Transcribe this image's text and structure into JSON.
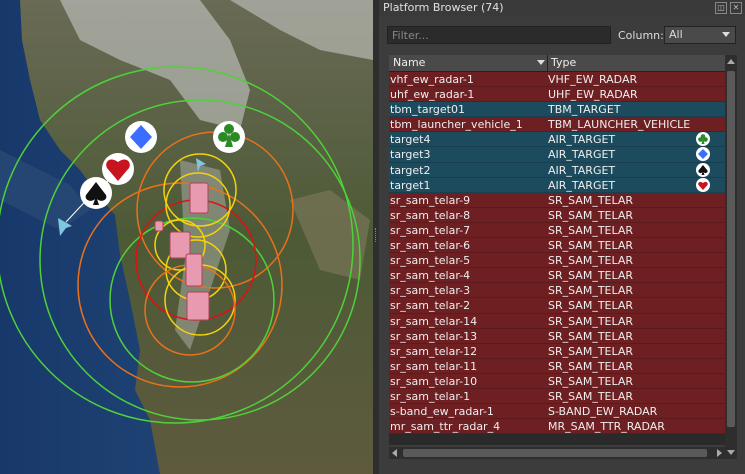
{
  "panel": {
    "title": "Platform Browser (74)",
    "filter_placeholder": "Filter...",
    "column_label": "Column:",
    "column_value": "All"
  },
  "table": {
    "headers": [
      "Name",
      "Type"
    ],
    "rows": [
      {
        "name": "vhf_ew_radar-1",
        "type": "VHF_EW_RADAR",
        "color": "red",
        "icon": ""
      },
      {
        "name": "uhf_ew_radar-1",
        "type": "UHF_EW_RADAR",
        "color": "red",
        "icon": ""
      },
      {
        "name": "tbm_target01",
        "type": "TBM_TARGET",
        "color": "teal",
        "icon": ""
      },
      {
        "name": "tbm_launcher_vehicle_1",
        "type": "TBM_LAUNCHER_VEHICLE",
        "color": "red",
        "icon": ""
      },
      {
        "name": "target4",
        "type": "AIR_TARGET",
        "color": "teal",
        "icon": "club-icon"
      },
      {
        "name": "target3",
        "type": "AIR_TARGET",
        "color": "teal",
        "icon": "diamond-icon"
      },
      {
        "name": "target2",
        "type": "AIR_TARGET",
        "color": "teal",
        "icon": "spade-icon"
      },
      {
        "name": "target1",
        "type": "AIR_TARGET",
        "color": "teal",
        "icon": "heart-icon"
      },
      {
        "name": "sr_sam_telar-9",
        "type": "SR_SAM_TELAR",
        "color": "red",
        "icon": ""
      },
      {
        "name": "sr_sam_telar-8",
        "type": "SR_SAM_TELAR",
        "color": "red",
        "icon": ""
      },
      {
        "name": "sr_sam_telar-7",
        "type": "SR_SAM_TELAR",
        "color": "red",
        "icon": ""
      },
      {
        "name": "sr_sam_telar-6",
        "type": "SR_SAM_TELAR",
        "color": "red",
        "icon": ""
      },
      {
        "name": "sr_sam_telar-5",
        "type": "SR_SAM_TELAR",
        "color": "red",
        "icon": ""
      },
      {
        "name": "sr_sam_telar-4",
        "type": "SR_SAM_TELAR",
        "color": "red",
        "icon": ""
      },
      {
        "name": "sr_sam_telar-3",
        "type": "SR_SAM_TELAR",
        "color": "red",
        "icon": ""
      },
      {
        "name": "sr_sam_telar-2",
        "type": "SR_SAM_TELAR",
        "color": "red",
        "icon": ""
      },
      {
        "name": "sr_sam_telar-14",
        "type": "SR_SAM_TELAR",
        "color": "red",
        "icon": ""
      },
      {
        "name": "sr_sam_telar-13",
        "type": "SR_SAM_TELAR",
        "color": "red",
        "icon": ""
      },
      {
        "name": "sr_sam_telar-12",
        "type": "SR_SAM_TELAR",
        "color": "red",
        "icon": ""
      },
      {
        "name": "sr_sam_telar-11",
        "type": "SR_SAM_TELAR",
        "color": "red",
        "icon": ""
      },
      {
        "name": "sr_sam_telar-10",
        "type": "SR_SAM_TELAR",
        "color": "red",
        "icon": ""
      },
      {
        "name": "sr_sam_telar-1",
        "type": "SR_SAM_TELAR",
        "color": "red",
        "icon": ""
      },
      {
        "name": "s-band_ew_radar-1",
        "type": "S-BAND_EW_RADAR",
        "color": "red",
        "icon": ""
      },
      {
        "name": "mr_sam_ttr_radar_4",
        "type": "MR_SAM_TTR_RADAR",
        "color": "red",
        "icon": ""
      }
    ]
  },
  "colors": {
    "red_row": "#6e1f22",
    "teal_row": "#1d4b5e",
    "range_green": "#4fd13a",
    "range_orange": "#e8711c",
    "range_red": "#e01010",
    "range_yellow": "#f5d20c"
  }
}
